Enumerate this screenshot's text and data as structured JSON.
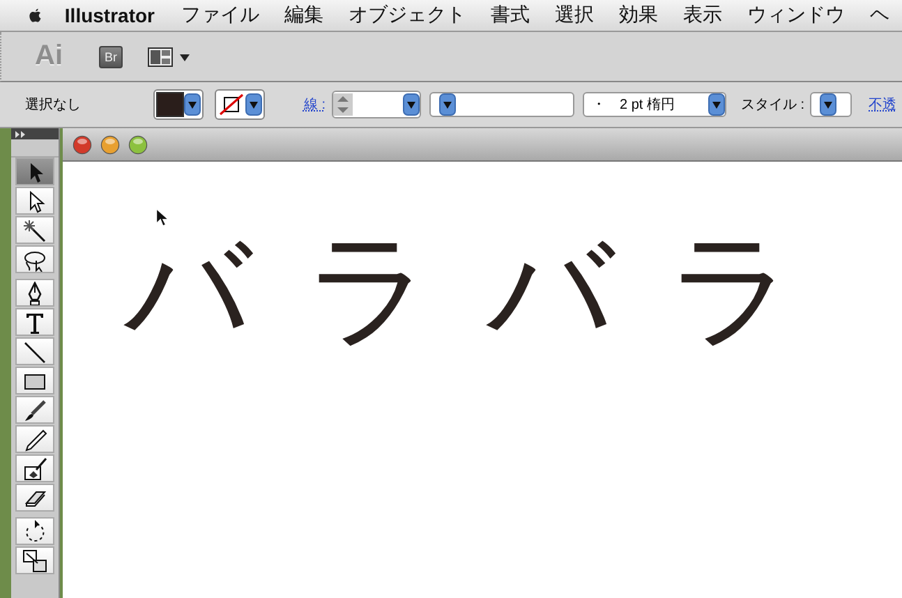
{
  "menu_bar": {
    "app_name": "Illustrator",
    "items": [
      "ファイル",
      "編集",
      "オブジェクト",
      "書式",
      "選択",
      "効果",
      "表示",
      "ウィンドウ",
      "ヘ"
    ]
  },
  "app_bar": {
    "logo": "Ai",
    "bridge_button": "Br"
  },
  "control_bar": {
    "selection_status": "選択なし",
    "stroke_label": "線 :",
    "brush_dropdown": "・　2 pt 楕円",
    "style_label": "スタイル :",
    "opacity_link": "不透"
  },
  "toolbox": {
    "tools": [
      {
        "selected": true
      },
      {
        "selected": false
      },
      {
        "selected": false
      },
      {
        "selected": false
      },
      {
        "selected": false
      },
      {
        "selected": false
      },
      {
        "selected": false
      },
      {
        "selected": false
      },
      {
        "selected": false
      },
      {
        "selected": false
      },
      {
        "selected": false
      },
      {
        "selected": false
      },
      {
        "selected": false
      },
      {
        "selected": false
      }
    ]
  },
  "document": {
    "canvas_text": "バラバラ"
  }
}
